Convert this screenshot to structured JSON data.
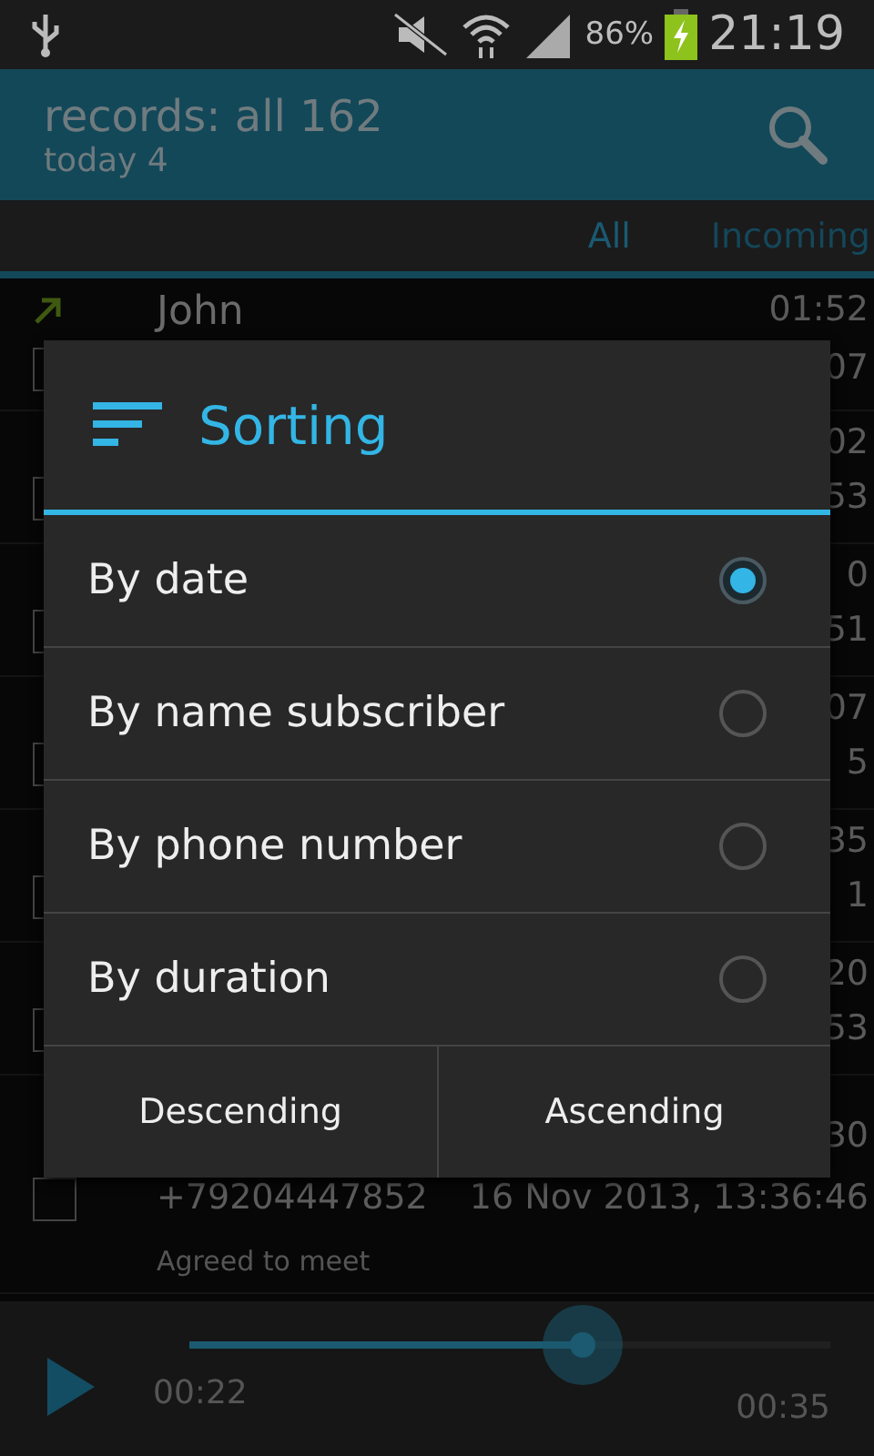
{
  "status_bar": {
    "battery": "86%",
    "time": "21:19"
  },
  "header": {
    "title": "records: all 162",
    "subtitle": "today 4"
  },
  "tabs": [
    {
      "label": "All",
      "selected": true
    },
    {
      "label": "Incoming",
      "selected": false
    }
  ],
  "records": [
    {
      "kind": "outgoing",
      "name": "John",
      "duration": "01:52",
      "date": "07",
      "checked": false
    },
    {
      "duration": "02",
      "date": "53",
      "checked": false
    },
    {
      "duration": "0",
      "date": "51",
      "checked": false
    },
    {
      "duration": "07",
      "date": "5",
      "checked": false
    },
    {
      "duration": "35",
      "date": "1",
      "checked": false
    },
    {
      "duration": "20",
      "date": "53",
      "checked": false
    },
    {
      "duration": "30",
      "number": "+79204447852",
      "date": "16 Nov 2013, 13:36:46",
      "note": "Agreed to meet",
      "checked": false
    }
  ],
  "dialog": {
    "title": "Sorting",
    "options": [
      {
        "label": "By date",
        "selected": true
      },
      {
        "label": "By name subscriber",
        "selected": false
      },
      {
        "label": "By phone number",
        "selected": false
      },
      {
        "label": "By duration",
        "selected": false
      }
    ],
    "buttons": [
      "Descending",
      "Ascending"
    ]
  },
  "player": {
    "level": 0.615,
    "elapsed": "00:22",
    "total": "00:35"
  }
}
